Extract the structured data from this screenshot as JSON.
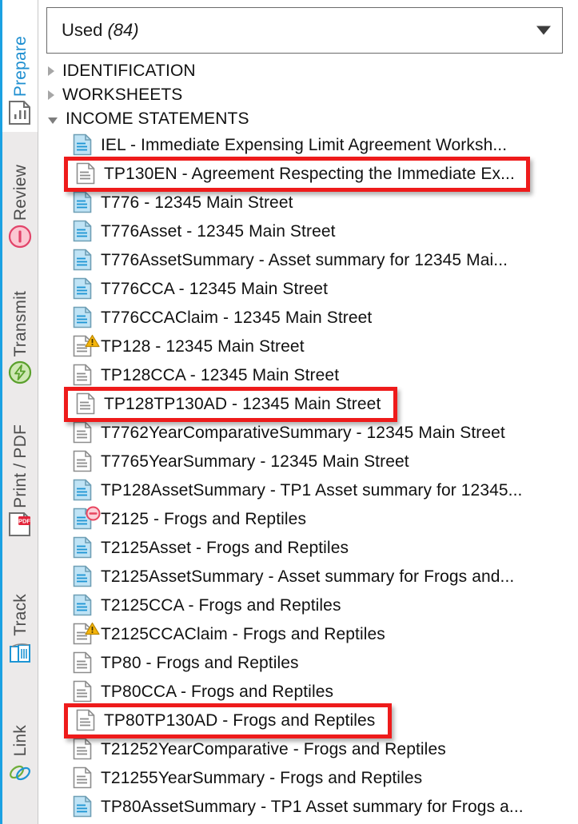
{
  "sidebar": {
    "accent_color": "#1ba1e2",
    "tabs": [
      {
        "label": "Prepare",
        "icon": "document-chart-icon",
        "active": true
      },
      {
        "label": "Review",
        "icon": "review-circle-icon",
        "active": false
      },
      {
        "label": "Transmit",
        "icon": "transmit-bolt-icon",
        "active": false
      },
      {
        "label": "Print / PDF",
        "icon": "pdf-document-icon",
        "active": false
      },
      {
        "label": "Track",
        "icon": "track-book-icon",
        "active": false
      },
      {
        "label": "Link",
        "icon": "link-chain-icon",
        "active": false
      }
    ]
  },
  "filter": {
    "label": "Used",
    "count": "(84)",
    "dropdown_icon": "chevron-down-icon"
  },
  "tree": {
    "groups": [
      {
        "label": "IDENTIFICATION",
        "expanded": false
      },
      {
        "label": "WORKSHEETS",
        "expanded": false
      },
      {
        "label": "INCOME STATEMENTS",
        "expanded": true
      }
    ],
    "rows": [
      {
        "label": "IEL - Immediate Expensing Limit Agreement Worksh...",
        "icon": "document-blue-icon",
        "badge": "none",
        "highlight": false
      },
      {
        "label": "TP130EN - Agreement Respecting the Immediate Ex...",
        "icon": "document-white-icon",
        "badge": "none",
        "highlight": true
      },
      {
        "label": "T776 - 12345 Main Street",
        "icon": "document-blue-icon",
        "badge": "none",
        "highlight": false
      },
      {
        "label": "T776Asset - 12345 Main Street",
        "icon": "document-blue-icon",
        "badge": "none",
        "highlight": false
      },
      {
        "label": "T776AssetSummary - Asset summary for 12345 Mai...",
        "icon": "document-blue-icon",
        "badge": "none",
        "highlight": false
      },
      {
        "label": "T776CCA - 12345 Main Street",
        "icon": "document-blue-icon",
        "badge": "none",
        "highlight": false
      },
      {
        "label": "T776CCAClaim - 12345 Main Street",
        "icon": "document-blue-icon",
        "badge": "none",
        "highlight": false
      },
      {
        "label": "TP128 - 12345 Main Street",
        "icon": "document-white-icon",
        "badge": "warning",
        "highlight": false
      },
      {
        "label": "TP128CCA - 12345 Main Street",
        "icon": "document-white-icon",
        "badge": "none",
        "highlight": false
      },
      {
        "label": "TP128TP130AD - 12345 Main Street",
        "icon": "document-white-icon",
        "badge": "none",
        "highlight": true
      },
      {
        "label": "T7762YearComparativeSummary - 12345 Main Street",
        "icon": "document-white-icon",
        "badge": "none",
        "highlight": false
      },
      {
        "label": "T7765YearSummary - 12345 Main Street",
        "icon": "document-white-icon",
        "badge": "none",
        "highlight": false
      },
      {
        "label": "TP128AssetSummary - TP1 Asset summary for 12345...",
        "icon": "document-blue-icon",
        "badge": "none",
        "highlight": false
      },
      {
        "label": "T2125 - Frogs and Reptiles",
        "icon": "document-blue-icon",
        "badge": "error",
        "highlight": false
      },
      {
        "label": "T2125Asset - Frogs and Reptiles",
        "icon": "document-blue-icon",
        "badge": "none",
        "highlight": false
      },
      {
        "label": "T2125AssetSummary - Asset summary for Frogs and...",
        "icon": "document-blue-icon",
        "badge": "none",
        "highlight": false
      },
      {
        "label": "T2125CCA - Frogs and Reptiles",
        "icon": "document-blue-icon",
        "badge": "none",
        "highlight": false
      },
      {
        "label": "T2125CCAClaim - Frogs and Reptiles",
        "icon": "document-white-icon",
        "badge": "warning",
        "highlight": false
      },
      {
        "label": "TP80 - Frogs and Reptiles",
        "icon": "document-white-icon",
        "badge": "none",
        "highlight": false
      },
      {
        "label": "TP80CCA - Frogs and Reptiles",
        "icon": "document-white-icon",
        "badge": "none",
        "highlight": false
      },
      {
        "label": "TP80TP130AD - Frogs and Reptiles",
        "icon": "document-white-icon",
        "badge": "none",
        "highlight": true
      },
      {
        "label": "T21252YearComparative - Frogs and Reptiles",
        "icon": "document-white-icon",
        "badge": "none",
        "highlight": false
      },
      {
        "label": "T21255YearSummary - Frogs and Reptiles",
        "icon": "document-white-icon",
        "badge": "none",
        "highlight": false
      },
      {
        "label": "TP80AssetSummary - TP1 Asset summary for Frogs a...",
        "icon": "document-blue-icon",
        "badge": "none",
        "highlight": false
      }
    ]
  },
  "colors": {
    "accent": "#1ba1e2",
    "annotation": "#ee1b1b",
    "doc_blue_fill": "#bfe3f5",
    "doc_blue_line": "#1d95d4",
    "warning": "#f5b50a",
    "error": "#e8455f"
  }
}
